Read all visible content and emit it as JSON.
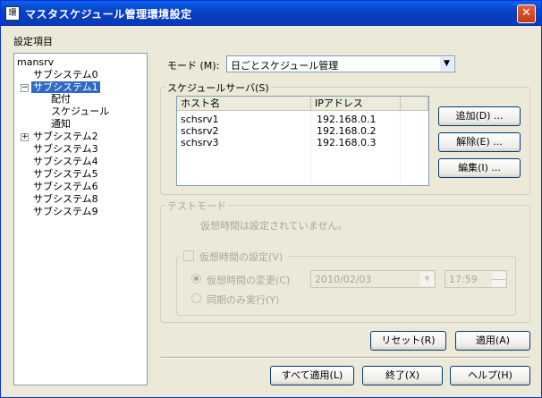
{
  "window": {
    "title": "マスタスケジュール管理環境設定",
    "icon_text": "環",
    "close_glyph": "✕"
  },
  "settings_header": "設定項目",
  "tree": {
    "root": "mansrv",
    "items": [
      {
        "label": "サブシステム0"
      },
      {
        "label": "サブシステム1",
        "expander": "−"
      },
      {
        "label": "配付"
      },
      {
        "label": "スケジュール"
      },
      {
        "label": "通知"
      },
      {
        "label": "サブシステム2",
        "expander": "+"
      },
      {
        "label": "サブシステム3"
      },
      {
        "label": "サブシステム4"
      },
      {
        "label": "サブシステム5"
      },
      {
        "label": "サブシステム6"
      },
      {
        "label": "サブシステム8"
      },
      {
        "label": "サブシステム9"
      }
    ]
  },
  "mode": {
    "label": "モード (M):",
    "value": "日ごとスケジュール管理",
    "arrow": "▼"
  },
  "schedule_server": {
    "group_title": "スケジュールサーバ(S)",
    "columns": [
      "ホスト名",
      "IPアドレス"
    ],
    "rows": [
      [
        "schsrv1",
        "192.168.0.1"
      ],
      [
        "schsrv2",
        "192.168.0.2"
      ],
      [
        "schsrv3",
        "192.168.0.3"
      ]
    ],
    "add_label": "追加(D) ...",
    "remove_label": "解除(E) ...",
    "edit_label": "編集(I) ..."
  },
  "test_mode": {
    "group_title": "テストモード",
    "status_text": "仮想時間は設定されていません。",
    "virtual_time_checkbox": "仮想時間の設定(V)",
    "change_radio": "仮想時間の変更(C)",
    "date_value": "2010/02/03",
    "time_value": "17:59",
    "sync_radio": "同期のみ実行(Y)"
  },
  "buttons": {
    "reset": "リセット(R)",
    "apply": "適用(A)",
    "apply_all": "すべて適用(L)",
    "exit": "終了(X)",
    "help": "ヘルプ(H)"
  }
}
